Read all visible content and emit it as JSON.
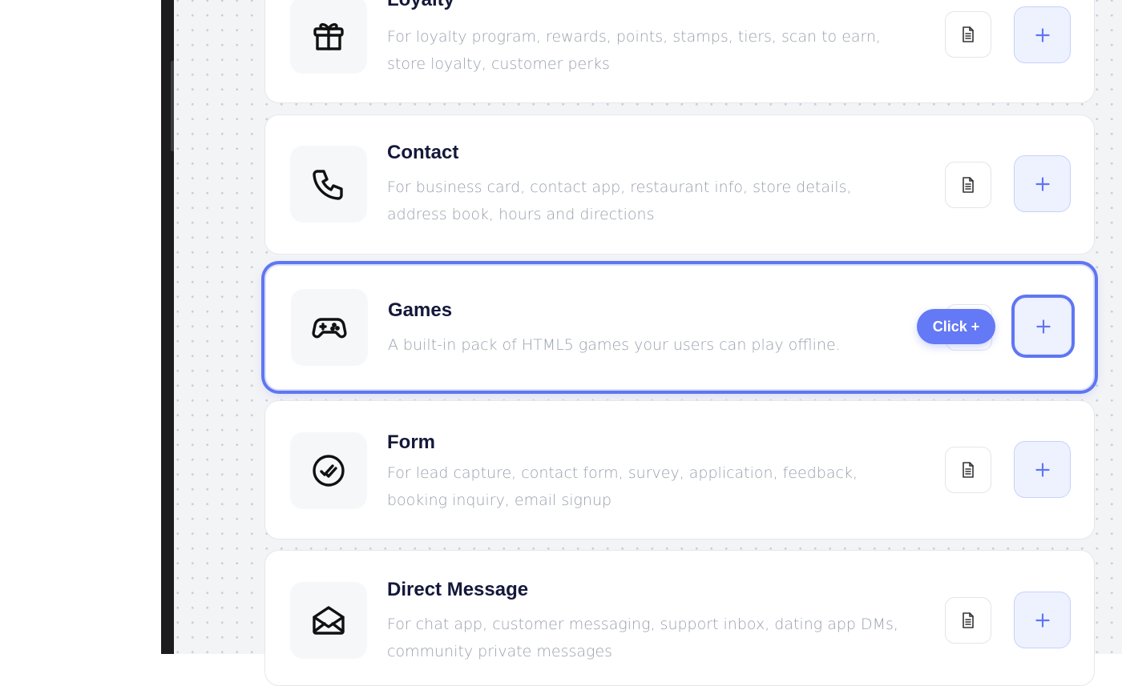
{
  "cards": [
    {
      "id": "loyalty",
      "title": "Loyalty",
      "description": "For loyalty program, rewards, points, stamps, tiers, scan to earn, store loyalty, customer perks",
      "icon": "gift-icon"
    },
    {
      "id": "contact",
      "title": "Contact",
      "description": "For business card, contact app, restaurant info, store details, address book, hours and directions",
      "icon": "phone-icon"
    },
    {
      "id": "games",
      "title": "Games",
      "description": "A built-in pack of HTML5 games your users can play offline.",
      "icon": "gamepad-icon",
      "selected": true
    },
    {
      "id": "form",
      "title": "Form",
      "description": "For lead capture, contact form, survey, application, feedback, booking inquiry, email signup",
      "icon": "check-circle-icon"
    },
    {
      "id": "direct-message",
      "title": "Direct Message",
      "description": "For chat app, customer messaging, support inbox, dating app DMs, community private messages",
      "icon": "envelope-open-icon"
    }
  ],
  "tooltip": {
    "label": "Click +"
  },
  "colors": {
    "accent": "#5f76f2",
    "title": "#14183a",
    "description": "#9aa0ad",
    "canvas": "#f3f4f6"
  }
}
